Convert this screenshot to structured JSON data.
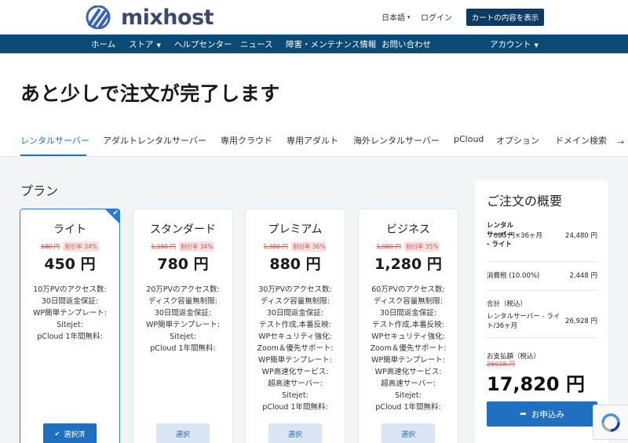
{
  "header": {
    "logo_text": "mixhost",
    "language": "日本語",
    "login": "ログイン",
    "cart_button": "カートの内容を表示"
  },
  "nav": {
    "items": [
      {
        "label": "ホーム",
        "dropdown": false
      },
      {
        "label": "ストア",
        "dropdown": true
      },
      {
        "label": "ヘルプセンター",
        "dropdown": false
      },
      {
        "label": "ニュース",
        "dropdown": false
      },
      {
        "label": "障害・メンテナンス情報",
        "dropdown": false
      },
      {
        "label": "お問い合わせ",
        "dropdown": false
      }
    ],
    "account": "アカウント"
  },
  "page_title": "あと少しで注文が完了します",
  "tabs": [
    "レンタルサーバー",
    "アダルトレンタルサーバー",
    "専用クラウド",
    "専用アダルト",
    "海外レンタルサーバー",
    "pCloud",
    "オプション",
    "ドメイン検索"
  ],
  "active_tab": "レンタルサーバー",
  "plans_heading": "プラン",
  "plans": [
    {
      "name": "ライト",
      "old_price": "680 円",
      "discount": "割引率 34%",
      "price": "450 円",
      "features": [
        "10万PVのアクセス数:",
        "30日間返金保証:",
        "WP簡単テンプレート:",
        "Sitejet:",
        "pCloud 1年間無料:"
      ],
      "button": "選択済",
      "selected": true
    },
    {
      "name": "スタンダード",
      "old_price": "1,180 円",
      "discount": "割引率 34%",
      "price": "780 円",
      "features": [
        "20万PVのアクセス数:",
        "ディスク容量無制限:",
        "30日間返金保証:",
        "WP簡単テンプレート:",
        "Sitejet:",
        "pCloud 1年間無料:"
      ],
      "button": "選択",
      "selected": false
    },
    {
      "name": "プレミアム",
      "old_price": "1,380 円",
      "discount": "割引率 36%",
      "price": "880 円",
      "features": [
        "30万PVのアクセス数:",
        "ディスク容量無制限:",
        "30日間返金保証:",
        "テスト作成,本番反映:",
        "WPセキュリティ強化:",
        "Zoom＆優先サポート:",
        "WP簡単テンプレート:",
        "WP高速化サービス:",
        "超高速サーバー:",
        "Sitejet:",
        "pCloud 1年間無料:"
      ],
      "button": "選択",
      "selected": false
    },
    {
      "name": "ビジネス",
      "old_price": "1,980 円",
      "discount": "割引率 35%",
      "price": "1,280 円",
      "features": [
        "60万PVのアクセス数:",
        "ディスク容量無制限:",
        "30日間返金保証:",
        "テスト作成,本番反映:",
        "WPセキュリティ強化:",
        "Zoom＆優先サポート:",
        "WP簡単テンプレート:",
        "WP高速化サービス:",
        "超高速サーバー:",
        "Sitejet:",
        "pCloud 1年間無料:"
      ],
      "button": "選択",
      "selected": false
    }
  ],
  "summary": {
    "title": "ご注文の概要",
    "item_lines": [
      "レンタル",
      "サーバー",
      "- ライト"
    ],
    "item_unit": "680 円×36ヶ月",
    "item_total": "24,480 円",
    "tax_label": "消費税 (10.00%)",
    "tax_value": "2,448 円",
    "subtotal_label": "合計（税込）",
    "subtotal_item_lines": [
      "レンタルサーバー - ライ",
      "ト/36ヶ月"
    ],
    "subtotal_value": "26,928 円",
    "pay_label": "お支払額（税込）",
    "pay_old": "26928 円",
    "pay_total": "17,820 円",
    "order_button": "お申込み"
  },
  "colors": {
    "brand_dark": "#0d3a63",
    "nav_bg": "#0a4a75",
    "accent": "#1f70c1",
    "discount_red": "#d9534f"
  }
}
